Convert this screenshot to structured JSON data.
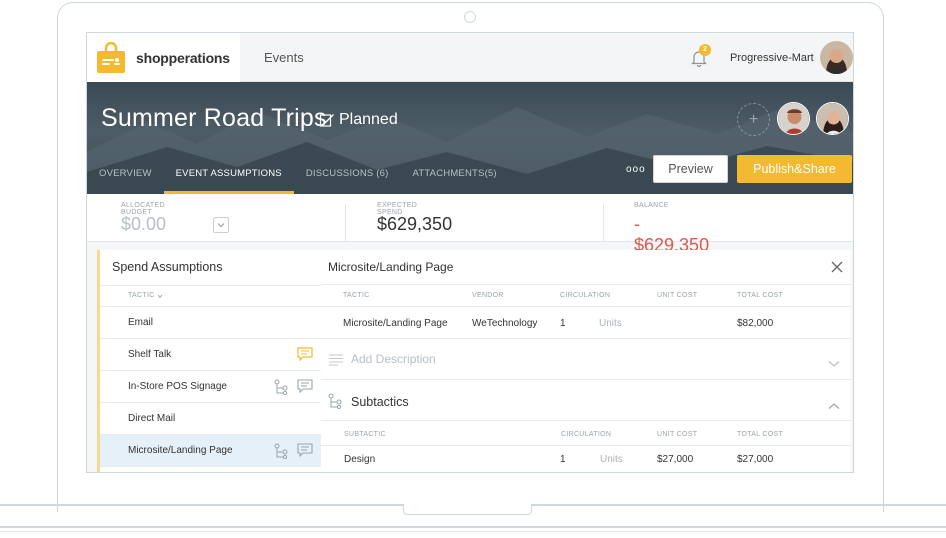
{
  "brand": {
    "name": "shopperations",
    "accent": "#f4b92e"
  },
  "nav": {
    "events": "Events"
  },
  "header": {
    "notification_count": "2",
    "org_name": "Progressive-Mart"
  },
  "event": {
    "title": "Summer Road Trips",
    "status": "Planned"
  },
  "tabs": [
    {
      "label": "OVERVIEW"
    },
    {
      "label": "EVENT ASSUMPTIONS"
    },
    {
      "label": "DISCUSSIONS (6)"
    },
    {
      "label": "ATTACHMENTS(5)"
    }
  ],
  "actions": {
    "more": "ooo",
    "preview": "Preview",
    "publish": "Publish&Share"
  },
  "summary": {
    "allocated_label": "ALLOCATED BUDGET",
    "allocated_value": "$0.00",
    "expected_label": "EXPECTED SPEND",
    "expected_value": "$629,350",
    "balance_label": "BALANCE",
    "balance_value": "- $629,350",
    "balance_color": "#e0574f"
  },
  "spend": {
    "title": "Spend Assumptions",
    "column": "TACTIC",
    "items": [
      {
        "label": "Email"
      },
      {
        "label": "Shelf Talk"
      },
      {
        "label": "In-Store POS Signage"
      },
      {
        "label": "Direct Mail"
      },
      {
        "label": "Microsite/Landing Page"
      }
    ]
  },
  "detail": {
    "title": "Microsite/Landing Page",
    "columns": {
      "tactic": "TACTIC",
      "vendor": "VENDOR",
      "circulation": "CIRCULATION",
      "unit_cost": "UNIT COST",
      "total_cost": "TOTAL COST"
    },
    "row": {
      "tactic": "Microsite/Landing Page",
      "vendor": "WeTechnology",
      "circulation": "1",
      "units": "Units",
      "unit_cost": "",
      "total_cost": "$82,000"
    },
    "add_description": "Add Description",
    "subtactics_title": "Subtactics",
    "sub_columns": {
      "subtactic": "SUBTACTIC",
      "circulation": "CIRCULATION",
      "unit_cost": "UNIT COST",
      "total_cost": "TOTAL COST"
    },
    "sub_row": {
      "subtactic": "Design",
      "circulation": "1",
      "units": "Units",
      "unit_cost": "$27,000",
      "total_cost": "$27,000"
    }
  }
}
